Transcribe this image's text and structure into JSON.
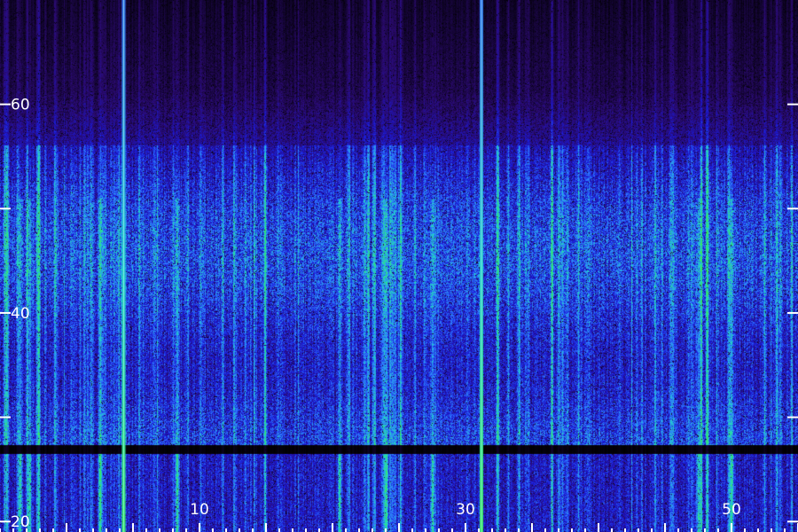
{
  "chart_data": {
    "type": "heatmap",
    "title": "",
    "xlabel": "",
    "ylabel": "",
    "x_ticks": [
      {
        "value": 10,
        "label": "10"
      },
      {
        "value": 30,
        "label": "30"
      },
      {
        "value": 50,
        "label": "50"
      }
    ],
    "x_minor_ticks": [
      0,
      5,
      10,
      15,
      20,
      25,
      30,
      35,
      40,
      45,
      50,
      55,
      60
    ],
    "xlim": [
      -5,
      55
    ],
    "y_ticks": [
      {
        "value": 20,
        "label": "20"
      },
      {
        "value": 40,
        "label": "40"
      },
      {
        "value": 60,
        "label": "60"
      }
    ],
    "y_minor_ticks": [
      30,
      50
    ],
    "ylim": [
      19,
      70
    ],
    "colormap": [
      "#000000",
      "#2a0a6e",
      "#1a1ad8",
      "#2f7dff",
      "#21d4c8",
      "#35e860"
    ],
    "background": "#000000",
    "features": {
      "strong_vertical_lines_x": [
        4.3,
        31.2
      ],
      "bright_low_lines_x": [
        -3.5,
        -2.8,
        2.5,
        8.3,
        20.5,
        24,
        27.5,
        47.5,
        50
      ],
      "horizontal_gap_y": 27,
      "band_y": [
        27,
        51
      ]
    }
  }
}
